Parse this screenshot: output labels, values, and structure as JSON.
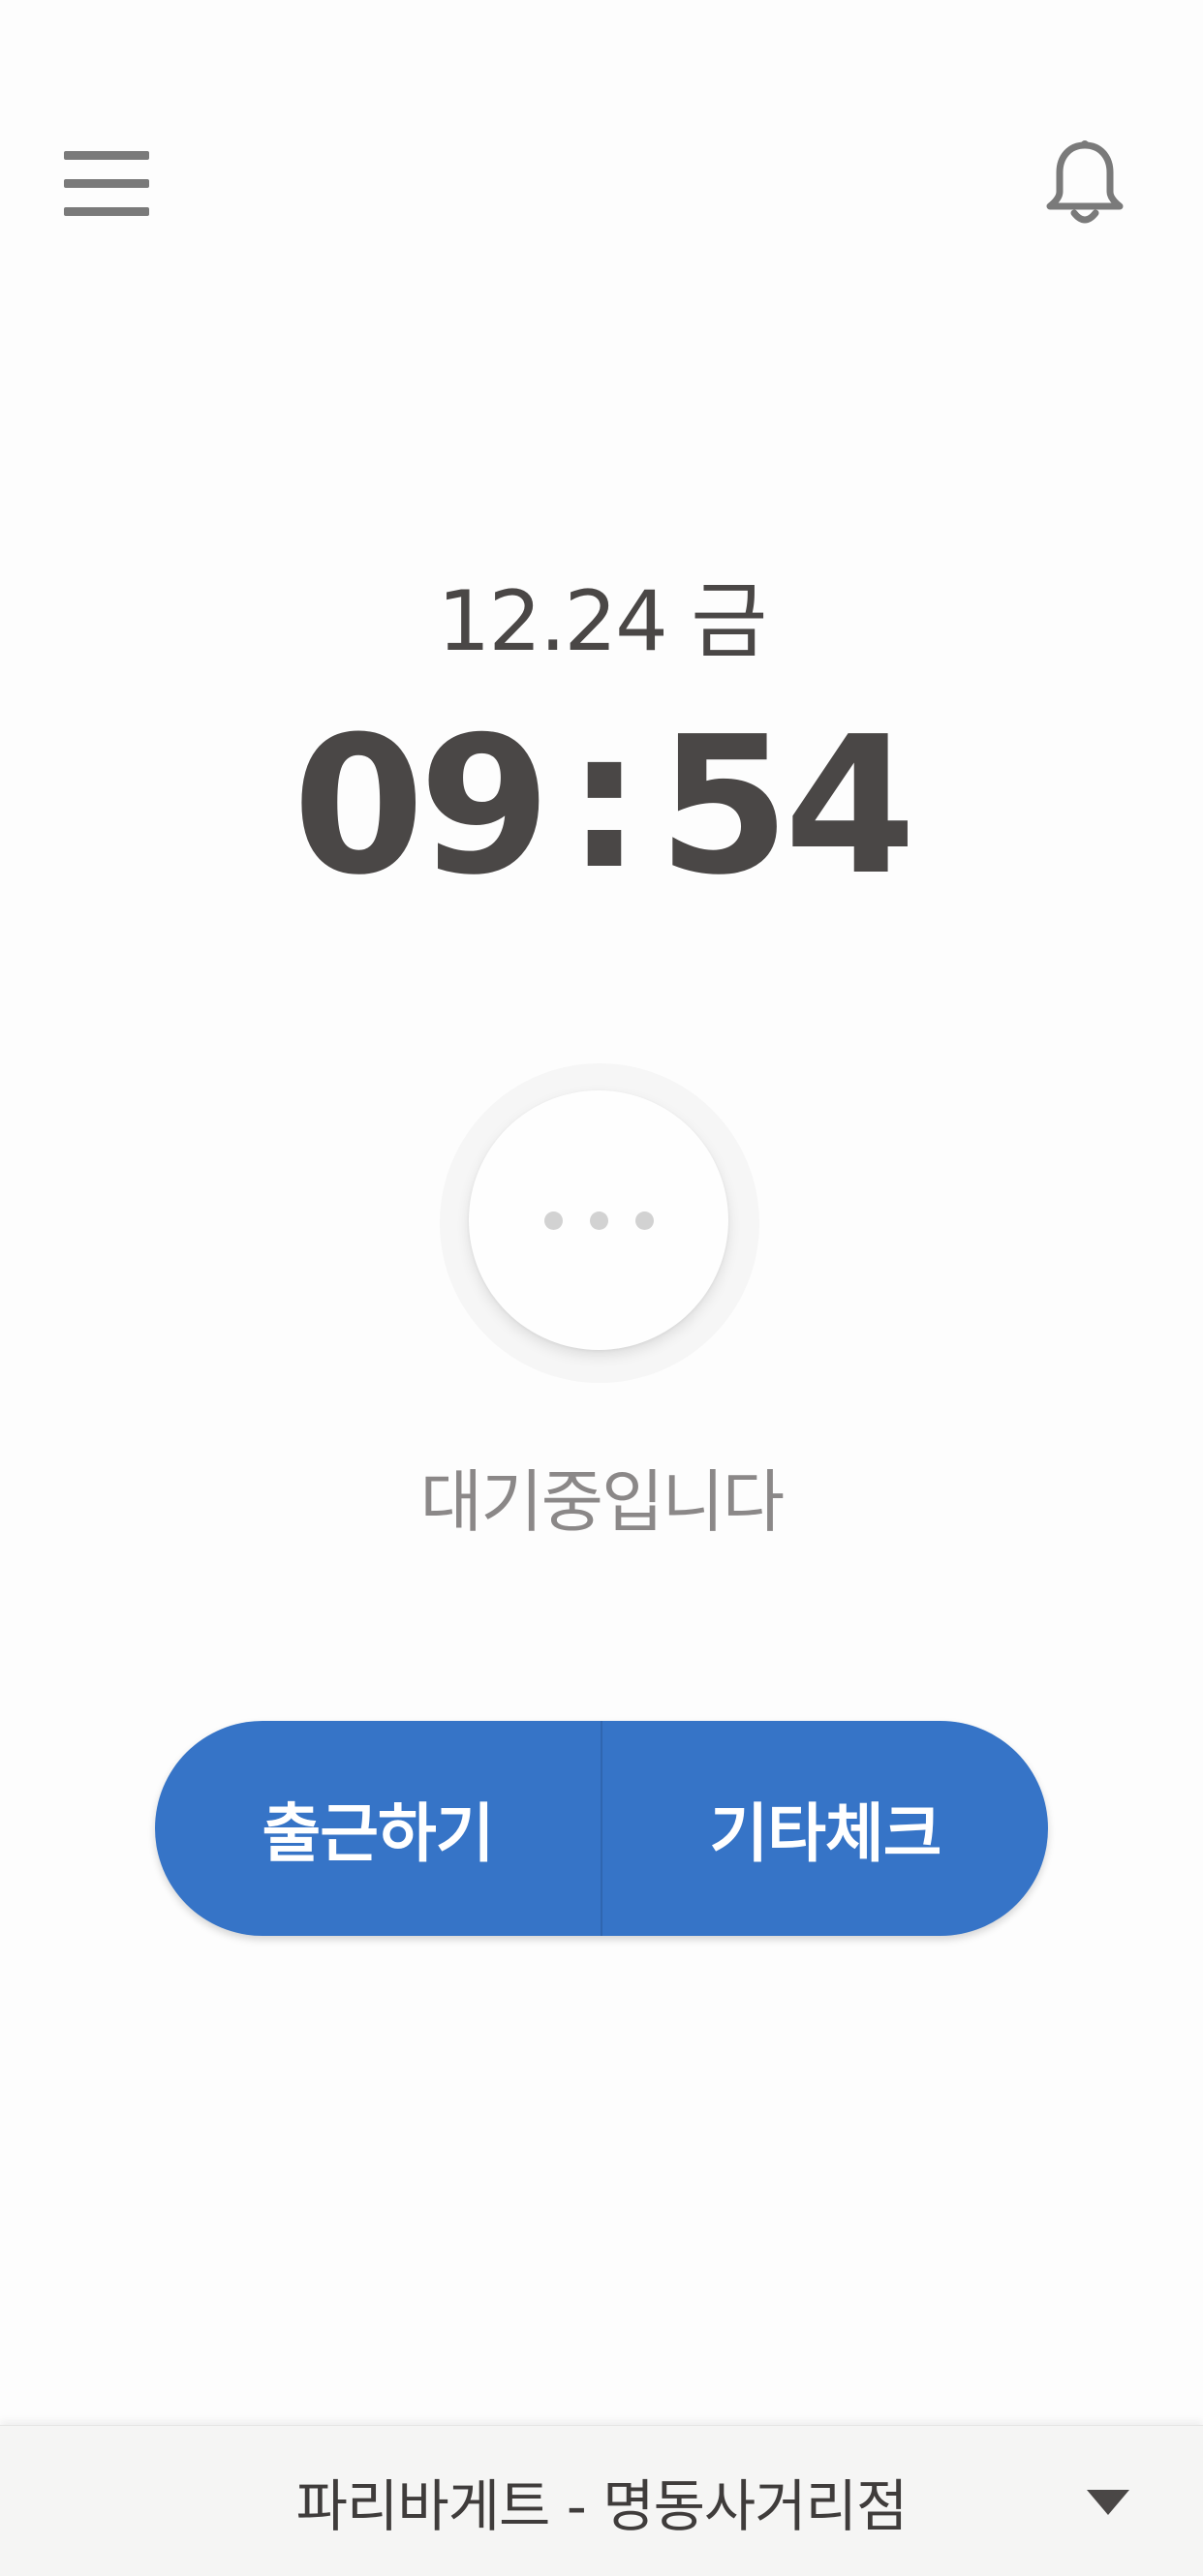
{
  "header": {
    "menu_icon": "hamburger-menu-icon",
    "notification_icon": "bell-icon"
  },
  "datetime": {
    "date": "12.24 금",
    "hour": "09",
    "separator": ":",
    "minute": "54"
  },
  "loader": {
    "icon": "ellipsis-icon",
    "status_text": "대기중입니다"
  },
  "actions": {
    "check_in_label": "출근하기",
    "other_check_label": "기타체크"
  },
  "footer": {
    "store_name": "파리바게트 - 명동사거리점",
    "dropdown_icon": "caret-down-icon"
  },
  "colors": {
    "primary": "#3674c7",
    "text": "#4a4746",
    "muted_text": "#8b8888",
    "icon": "#7a7a7a"
  }
}
